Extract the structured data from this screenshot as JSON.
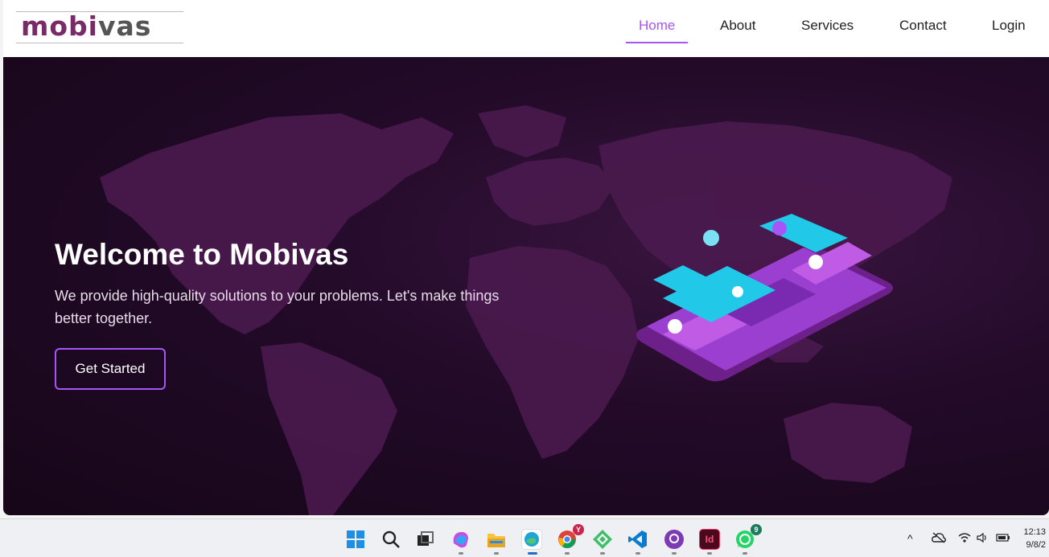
{
  "brand": {
    "logo_part1": "mobi",
    "logo_part2": "vas"
  },
  "nav": {
    "items": [
      {
        "label": "Home",
        "active": true
      },
      {
        "label": "About"
      },
      {
        "label": "Services"
      },
      {
        "label": "Contact"
      },
      {
        "label": "Login"
      }
    ]
  },
  "hero": {
    "title": "Welcome to Mobivas",
    "subtitle": "We provide high-quality solutions to your problems. Let's make things better together.",
    "cta_label": "Get Started"
  },
  "colors": {
    "accent": "#a855f7",
    "brand": "#7a2a66",
    "hero_bg": "#220a28",
    "map": "#4a1a4e"
  },
  "taskbar": {
    "icons": [
      "windows-start-icon",
      "search-icon",
      "task-view-icon",
      "copilot-icon",
      "file-explorer-icon",
      "edge-icon",
      "chrome-icon",
      "app-icon",
      "vscode-icon",
      "github-icon",
      "indesign-icon",
      "whatsapp-icon"
    ],
    "chrome_badge": "Y",
    "whatsapp_badge": "9",
    "indesign_label": "Id",
    "time": "12:13",
    "date": "9/8/2"
  }
}
